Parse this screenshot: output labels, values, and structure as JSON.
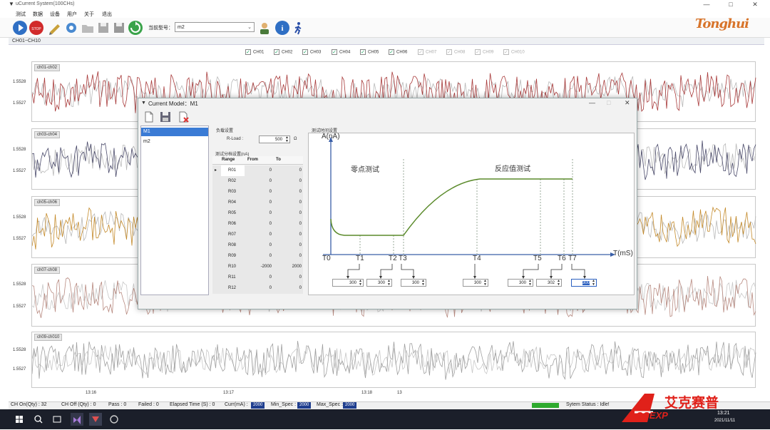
{
  "window": {
    "title": "uCurrent System(100CHs)",
    "min_btn": "—",
    "max_btn": "□",
    "close_btn": "✕"
  },
  "menu": [
    "测试",
    "数据",
    "设备",
    "用户",
    "关于",
    "退出"
  ],
  "toolbar": {
    "model_label": "当前型号：",
    "model_value": "m2",
    "brand": "Tonghui"
  },
  "panel": {
    "title": "CH01~CH10"
  },
  "channels": [
    {
      "label": "CH01",
      "checked": true
    },
    {
      "label": "CH02",
      "checked": true
    },
    {
      "label": "CH03",
      "checked": true
    },
    {
      "label": "CH04",
      "checked": true
    },
    {
      "label": "CH05",
      "checked": true
    },
    {
      "label": "CH06",
      "checked": true
    },
    {
      "label": "CH07",
      "checked": true
    },
    {
      "label": "CH08",
      "checked": true
    },
    {
      "label": "CH09",
      "checked": true
    },
    {
      "label": "CH010",
      "checked": true
    }
  ],
  "charts": [
    {
      "name": "ch01-ch02",
      "y_ticks": [
        "1.5528",
        "1.5527"
      ],
      "colors": [
        "#a83a3a",
        "#b9b9b9"
      ]
    },
    {
      "name": "ch03-ch04",
      "y_ticks": [
        "1.5528",
        "1.5527"
      ],
      "colors": [
        "#4a4a6a",
        "#b9b9b9"
      ]
    },
    {
      "name": "ch05-ch06",
      "y_ticks": [
        "1.5528",
        "1.5527"
      ],
      "colors": [
        "#c48a2a",
        "#b9b9b9"
      ]
    },
    {
      "name": "ch07-ch08",
      "y_ticks": [
        "1.5528",
        "1.5527"
      ],
      "colors": [
        "#b88a80",
        "#c8c8c8"
      ]
    },
    {
      "name": "ch09-ch010",
      "y_ticks": [
        "1.5528",
        "1.5527"
      ],
      "colors": [
        "#a0a0a0",
        "#c8c8c8"
      ]
    }
  ],
  "x_ticks": [
    "13:16",
    "13:17",
    "13:18",
    "13"
  ],
  "dialog": {
    "title": "Current Model：M1",
    "models": [
      "M1",
      "m2"
    ],
    "load_group": "负载设置",
    "rload_label": "R-Load :",
    "rload_value": "500",
    "rload_unit": "Ω",
    "range_group": "测试分档设置(nA)",
    "table_headers": [
      "Range",
      "From",
      "To"
    ],
    "ranges": [
      [
        "R01",
        "0",
        "0"
      ],
      [
        "R02",
        "0",
        "0"
      ],
      [
        "R03",
        "0",
        "0"
      ],
      [
        "R04",
        "0",
        "0"
      ],
      [
        "R05",
        "0",
        "0"
      ],
      [
        "R06",
        "0",
        "0"
      ],
      [
        "R07",
        "0",
        "0"
      ],
      [
        "R08",
        "0",
        "0"
      ],
      [
        "R09",
        "0",
        "0"
      ],
      [
        "R10",
        "-2000",
        "2000"
      ],
      [
        "R11",
        "0",
        "0"
      ],
      [
        "R12",
        "0",
        "0"
      ]
    ],
    "timing_group": "测试时间设置",
    "y_axis": "A(nA)",
    "x_axis": "T(mS)",
    "zero_test": "零点测试",
    "response_test": "反应值测试",
    "t_marks": [
      "T0",
      "T1",
      "T2",
      "T3",
      "T4",
      "T5",
      "T6",
      "T7"
    ],
    "t_inputs": [
      "300",
      "300",
      "300",
      "300",
      "300",
      "302",
      "300"
    ]
  },
  "status": {
    "ch_on": "CH On(Qty) : 32",
    "ch_off": "CH Off (Qty) : 0",
    "pass": "Pass : 0",
    "failed": "Failed : 0",
    "elapsed": "Elapsed Time (S) : 0",
    "curr_label": "Curr(mA) :",
    "curr_value": "2000",
    "min_label": "Min_Spec :",
    "min_value": "2000",
    "max_label": "Max_Spec :",
    "max_value": "2000",
    "system_status": "Sytem Status : Idle!"
  },
  "taskbar": {
    "time": "13:21",
    "date": "2021/11/11"
  },
  "watermark": {
    "cn": "艾克赛普",
    "en": "CCEXP"
  }
}
